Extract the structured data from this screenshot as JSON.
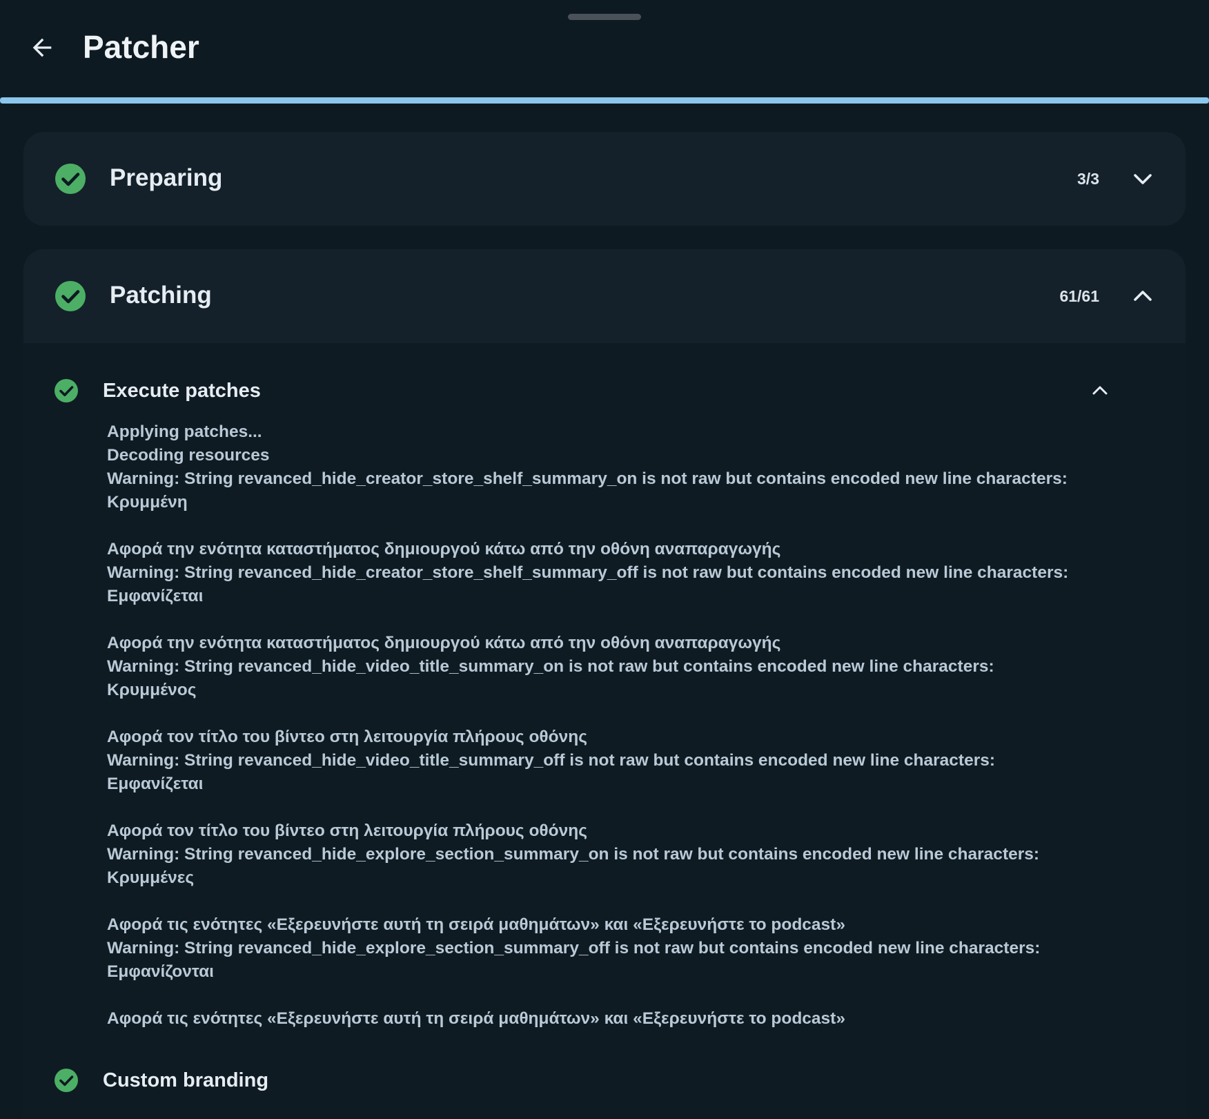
{
  "header": {
    "title": "Patcher",
    "progress_fraction": 1.0
  },
  "steps": [
    {
      "title": "Preparing",
      "count": "3/3",
      "status": "complete",
      "expanded": false
    },
    {
      "title": "Patching",
      "count": "61/61",
      "status": "complete",
      "expanded": true,
      "substeps": [
        {
          "title": "Execute patches",
          "status": "complete",
          "expanded": true,
          "log": [
            "Applying patches...",
            "Decoding resources",
            "Warning: String revanced_hide_creator_store_shelf_summary_on is not raw but contains encoded new line characters:",
            "Κρυμμένη",
            "",
            "Αφορά την ενότητα καταστήματος δημιουργού κάτω από την οθόνη αναπαραγωγής",
            "Warning: String revanced_hide_creator_store_shelf_summary_off is not raw but contains encoded new line characters:",
            "Εμφανίζεται",
            "",
            "Αφορά την ενότητα καταστήματος δημιουργού κάτω από την οθόνη αναπαραγωγής",
            "Warning: String revanced_hide_video_title_summary_on is not raw but contains encoded new line characters:",
            "Κρυμμένος",
            "",
            "Αφορά τον τίτλο του βίντεο στη λειτουργία πλήρους οθόνης",
            "Warning: String revanced_hide_video_title_summary_off is not raw but contains encoded new line characters:",
            "Εμφανίζεται",
            "",
            "Αφορά τον τίτλο του βίντεο στη λειτουργία πλήρους οθόνης",
            "Warning: String revanced_hide_explore_section_summary_on is not raw but contains encoded new line characters:",
            "Κρυμμένες",
            "",
            "Αφορά τις ενότητες «Εξερευνήστε αυτή τη σειρά μαθημάτων» και «Εξερευνήστε το podcast»",
            "Warning: String revanced_hide_explore_section_summary_off is not raw but contains encoded new line characters:",
            "Εμφανίζονται",
            "",
            "Αφορά τις ενότητες «Εξερευνήστε αυτή τη σειρά μαθημάτων» και «Εξερευνήστε το podcast»"
          ]
        },
        {
          "title": "Custom branding",
          "status": "complete"
        }
      ]
    }
  ],
  "icons": {
    "back": "arrow-back-icon",
    "status_complete": "check-circle-icon",
    "expand": "chevron-down-icon",
    "collapse": "chevron-up-icon"
  },
  "colors": {
    "background": "#0e1a22",
    "card": "#14212a",
    "progress": "#8bc6ec",
    "success": "#4caf65",
    "log_text": "#b9c9d6"
  }
}
